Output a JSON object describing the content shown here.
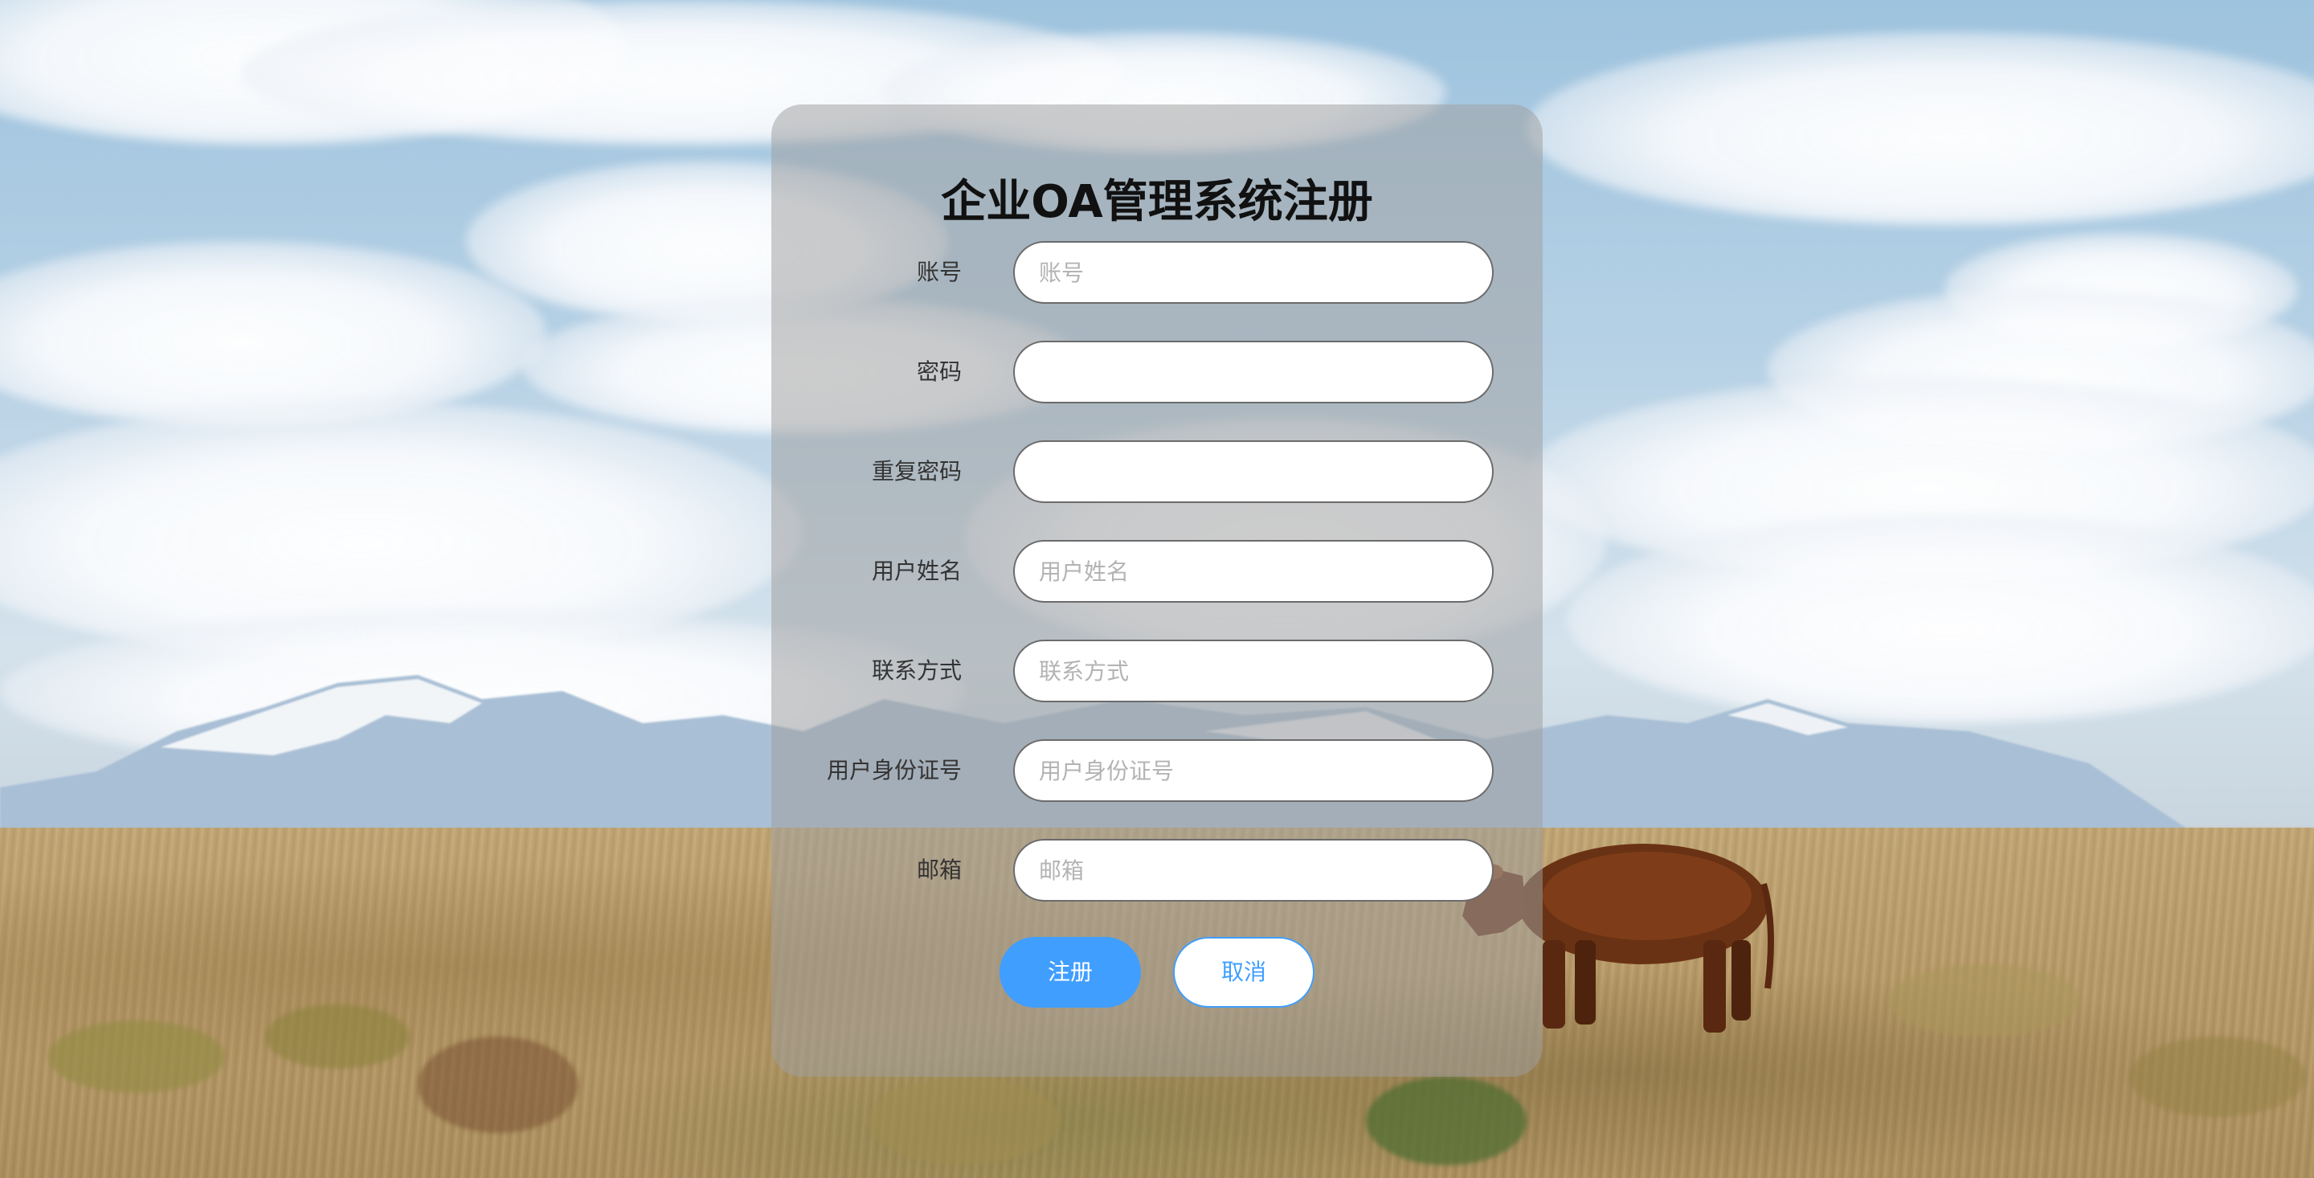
{
  "form": {
    "title": "企业OA管理系统注册",
    "fields": [
      {
        "label": "账号",
        "placeholder": "账号",
        "value": ""
      },
      {
        "label": "密码",
        "placeholder": "",
        "value": ""
      },
      {
        "label": "重复密码",
        "placeholder": "",
        "value": ""
      },
      {
        "label": "用户姓名",
        "placeholder": "用户姓名",
        "value": ""
      },
      {
        "label": "联系方式",
        "placeholder": "联系方式",
        "value": ""
      },
      {
        "label": "用户身份证号",
        "placeholder": "用户身份证号",
        "value": ""
      },
      {
        "label": "邮箱",
        "placeholder": "邮箱",
        "value": ""
      }
    ],
    "buttons": {
      "register_label": "注册",
      "cancel_label": "取消"
    }
  },
  "colors": {
    "primary": "#409eff",
    "panel_overlay": "rgba(160,160,160,0.52)"
  }
}
